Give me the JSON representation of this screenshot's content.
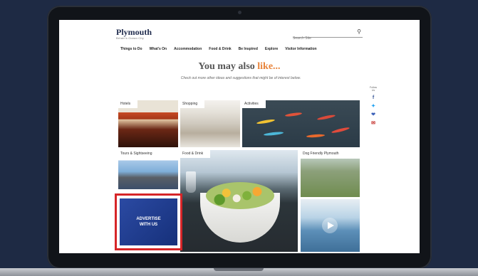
{
  "site": {
    "logo": "Plymouth",
    "tagline": "Britain's Ocean City"
  },
  "search": {
    "placeholder": "Search Site"
  },
  "nav": [
    "Things to Do",
    "What's On",
    "Accommodation",
    "Food & Drink",
    "Be Inspired",
    "Explore",
    "Visitor Information"
  ],
  "heading": {
    "main": "You may also",
    "accent": "like...",
    "subtext": "Check out more other ideas and suggestions that might be of interest below."
  },
  "tiles": {
    "hotels": "Hotels",
    "shopping": "Shopping",
    "activities": "Activities",
    "tours": "Tours & Sightseeing",
    "food": "Food & Drink",
    "dog": "Dog Friendly Plymouth"
  },
  "advert": {
    "label": "ADVERTISE WITH US",
    "border_color": "#d62528"
  },
  "share": {
    "caption": "Follow Us",
    "icons": [
      "facebook-icon",
      "twitter-icon",
      "heart-icon",
      "email-icon"
    ]
  },
  "colors": {
    "accent": "#e8843b",
    "background": "#1e2a44"
  }
}
